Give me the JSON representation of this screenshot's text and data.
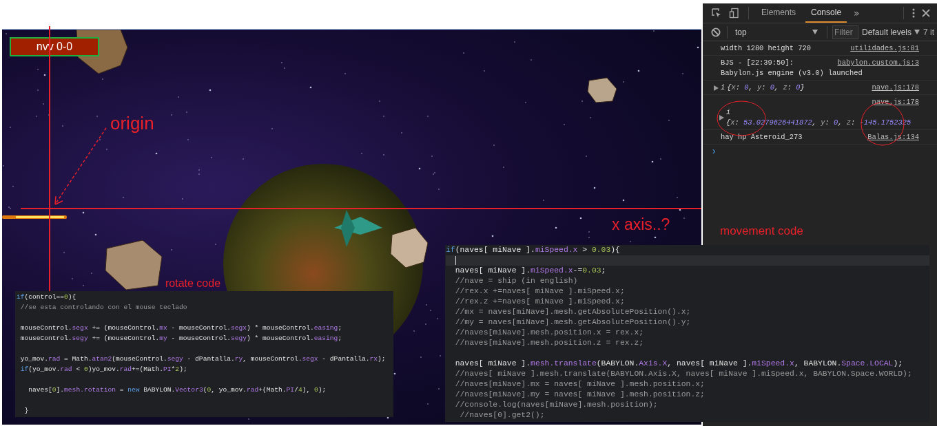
{
  "game": {
    "level_badge": "nvv 0-0"
  },
  "annotations": {
    "origin_label": "origin",
    "x_axis_label": "x axis..?",
    "rotate_label": "rotate code",
    "movement_label": "movement code"
  },
  "rotate_code": {
    "lines": [
      {
        "kind": "code",
        "tokens": [
          {
            "text": "if",
            "kind": "kw"
          },
          {
            "text": "(control==",
            "kind": "plain"
          },
          {
            "text": "0",
            "kind": "num"
          },
          {
            "text": "){",
            "kind": "plain"
          }
        ]
      },
      {
        "kind": "comment",
        "text": " //se esta controlando con el mouse teclado"
      },
      {
        "kind": "blank"
      },
      {
        "kind": "code",
        "tokens": [
          {
            "text": " mouseControl.",
            "kind": "plain"
          },
          {
            "text": "segx",
            "kind": "prop"
          },
          {
            "text": " += (mouseControl.",
            "kind": "plain"
          },
          {
            "text": "mx",
            "kind": "prop"
          },
          {
            "text": " - mouseControl.",
            "kind": "plain"
          },
          {
            "text": "segx",
            "kind": "prop"
          },
          {
            "text": ") * mouseControl.",
            "kind": "plain"
          },
          {
            "text": "easing",
            "kind": "prop"
          },
          {
            "text": ";",
            "kind": "plain"
          }
        ]
      },
      {
        "kind": "code",
        "tokens": [
          {
            "text": " mouseControl.",
            "kind": "plain"
          },
          {
            "text": "segy",
            "kind": "prop"
          },
          {
            "text": " += (mouseControl.",
            "kind": "plain"
          },
          {
            "text": "my",
            "kind": "prop"
          },
          {
            "text": " - mouseControl.",
            "kind": "plain"
          },
          {
            "text": "segy",
            "kind": "prop"
          },
          {
            "text": ") * mouseControl.",
            "kind": "plain"
          },
          {
            "text": "easing",
            "kind": "prop"
          },
          {
            "text": ";",
            "kind": "plain"
          }
        ]
      },
      {
        "kind": "blank"
      },
      {
        "kind": "code",
        "tokens": [
          {
            "text": " yo_mov.",
            "kind": "plain"
          },
          {
            "text": "rad",
            "kind": "prop"
          },
          {
            "text": " = Math.",
            "kind": "plain"
          },
          {
            "text": "atan2",
            "kind": "prop"
          },
          {
            "text": "(mouseControl.",
            "kind": "plain"
          },
          {
            "text": "segy",
            "kind": "prop"
          },
          {
            "text": " - dPantalla.",
            "kind": "plain"
          },
          {
            "text": "ry",
            "kind": "prop"
          },
          {
            "text": ", mouseControl.",
            "kind": "plain"
          },
          {
            "text": "segx",
            "kind": "prop"
          },
          {
            "text": " - dPantalla.",
            "kind": "plain"
          },
          {
            "text": "rx",
            "kind": "prop"
          },
          {
            "text": ");",
            "kind": "plain"
          }
        ]
      },
      {
        "kind": "code",
        "tokens": [
          {
            "text": " if",
            "kind": "kw"
          },
          {
            "text": "(yo_mov.",
            "kind": "plain"
          },
          {
            "text": "rad",
            "kind": "prop"
          },
          {
            "text": " < ",
            "kind": "plain"
          },
          {
            "text": "0",
            "kind": "num"
          },
          {
            "text": ")yo_mov.",
            "kind": "plain"
          },
          {
            "text": "rad",
            "kind": "prop"
          },
          {
            "text": "+=(Math.",
            "kind": "plain"
          },
          {
            "text": "PI",
            "kind": "prop"
          },
          {
            "text": "*",
            "kind": "plain"
          },
          {
            "text": "2",
            "kind": "num"
          },
          {
            "text": ");",
            "kind": "plain"
          }
        ]
      },
      {
        "kind": "blank"
      },
      {
        "kind": "code",
        "tokens": [
          {
            "text": "   naves[",
            "kind": "plain"
          },
          {
            "text": "0",
            "kind": "num"
          },
          {
            "text": "].",
            "kind": "plain"
          },
          {
            "text": "mesh.rotation",
            "kind": "prop"
          },
          {
            "text": " = ",
            "kind": "plain"
          },
          {
            "text": "new",
            "kind": "kw"
          },
          {
            "text": " BABYLON.",
            "kind": "plain"
          },
          {
            "text": "Vector3",
            "kind": "prop"
          },
          {
            "text": "(",
            "kind": "plain"
          },
          {
            "text": "0",
            "kind": "num"
          },
          {
            "text": ", yo_mov.",
            "kind": "plain"
          },
          {
            "text": "rad",
            "kind": "prop"
          },
          {
            "text": "+(Math.",
            "kind": "plain"
          },
          {
            "text": "PI",
            "kind": "prop"
          },
          {
            "text": "/",
            "kind": "plain"
          },
          {
            "text": "4",
            "kind": "num"
          },
          {
            "text": "), ",
            "kind": "plain"
          },
          {
            "text": "0",
            "kind": "num"
          },
          {
            "text": ");",
            "kind": "plain"
          }
        ]
      },
      {
        "kind": "blank"
      },
      {
        "kind": "code",
        "tokens": [
          {
            "text": "  }",
            "kind": "plain"
          }
        ]
      }
    ]
  },
  "movement_code": {
    "lines": [
      {
        "kind": "code",
        "tokens": [
          {
            "text": "if",
            "kind": "kw"
          },
          {
            "text": "(naves[ miNave ].",
            "kind": "plain"
          },
          {
            "text": "miSpeed.x",
            "kind": "prop"
          },
          {
            "text": " > ",
            "kind": "plain"
          },
          {
            "text": "0.03",
            "kind": "num"
          },
          {
            "text": "){",
            "kind": "plain"
          }
        ]
      },
      {
        "kind": "cursor"
      },
      {
        "kind": "code",
        "tokens": [
          {
            "text": "  naves[ miNave ].",
            "kind": "plain"
          },
          {
            "text": "miSpeed.x",
            "kind": "prop"
          },
          {
            "text": "-=",
            "kind": "plain"
          },
          {
            "text": "0.03",
            "kind": "num"
          },
          {
            "text": ";",
            "kind": "plain"
          }
        ]
      },
      {
        "kind": "comment",
        "text": "  //nave = ship (in english)"
      },
      {
        "kind": "comment",
        "text": "  //rex.x +=naves[ miNave ].miSpeed.x;"
      },
      {
        "kind": "comment",
        "text": "  //rex.z +=naves[ miNave ].miSpeed.x;"
      },
      {
        "kind": "comment",
        "text": "  //mx = naves[miNave].mesh.getAbsolutePosition().x;"
      },
      {
        "kind": "comment",
        "text": "  //my = naves[miNave].mesh.getAbsolutePosition().y;"
      },
      {
        "kind": "comment",
        "text": "  //naves[miNave].mesh.position.x = rex.x;"
      },
      {
        "kind": "comment",
        "text": "  //naves[miNave].mesh.position.z = rex.z;"
      },
      {
        "kind": "blank"
      },
      {
        "kind": "code",
        "tokens": [
          {
            "text": "  naves[ miNave ].",
            "kind": "plain"
          },
          {
            "text": "mesh.translate",
            "kind": "prop"
          },
          {
            "text": "(BABYLON.",
            "kind": "plain"
          },
          {
            "text": "Axis.X",
            "kind": "prop"
          },
          {
            "text": ", naves[ miNave ].",
            "kind": "plain"
          },
          {
            "text": "miSpeed.x",
            "kind": "prop"
          },
          {
            "text": ", BABYLON.",
            "kind": "plain"
          },
          {
            "text": "Space.LOCAL",
            "kind": "prop"
          },
          {
            "text": ");",
            "kind": "plain"
          }
        ]
      },
      {
        "kind": "comment",
        "text": "  //naves[ miNave ].mesh.translate(BABYLON.Axis.X, naves[ miNave ].miSpeed.x, BABYLON.Space.WORLD);"
      },
      {
        "kind": "comment",
        "text": "  //naves[miNave].mx = naves[ miNave ].mesh.position.x;"
      },
      {
        "kind": "comment",
        "text": "  //naves[miNave].my = naves[ miNave ].mesh.position.z;"
      },
      {
        "kind": "comment",
        "text": "  //console.log(naves[miNave].mesh.position);"
      },
      {
        "kind": "comment",
        "text": "   //naves[0].get2();"
      }
    ]
  },
  "devtools": {
    "tabs": [
      {
        "label": "Elements",
        "selected": false
      },
      {
        "label": "Console",
        "selected": true
      }
    ],
    "more_tabs": "»",
    "context": "top",
    "filter": {
      "placeholder": "Filter"
    },
    "levels": "Default levels",
    "hidden_count": "7 it",
    "messages": [
      {
        "kind": "text",
        "lines": [
          "width 1280 height 720"
        ],
        "source": "utilidades.js:81"
      },
      {
        "kind": "text",
        "lines": [
          "BJS - [22:39:50]:",
          "Babylon.js engine (v3.0) launched"
        ],
        "source": "babylon.custom.js:3"
      },
      {
        "kind": "object",
        "expanded": false,
        "label": "i",
        "tokens": [
          {
            "text": "{",
            "kind": "punct"
          },
          {
            "text": "x",
            "kind": "key"
          },
          {
            "text": ": ",
            "kind": "punct"
          },
          {
            "text": "0",
            "kind": "num"
          },
          {
            "text": ", ",
            "kind": "punct"
          },
          {
            "text": "y",
            "kind": "key"
          },
          {
            "text": ": ",
            "kind": "punct"
          },
          {
            "text": "0",
            "kind": "num"
          },
          {
            "text": ", ",
            "kind": "punct"
          },
          {
            "text": "z",
            "kind": "key"
          },
          {
            "text": ": ",
            "kind": "punct"
          },
          {
            "text": "0",
            "kind": "num"
          },
          {
            "text": "}",
            "kind": "punct"
          }
        ],
        "source": "nave.js:178"
      },
      {
        "kind": "object_wrapped",
        "expanded": false,
        "label": "i",
        "tokens": [
          {
            "text": "{",
            "kind": "punct"
          },
          {
            "text": "x",
            "kind": "key"
          },
          {
            "text": ": ",
            "kind": "punct"
          },
          {
            "text": "53.0279626441872",
            "kind": "num"
          },
          {
            "text": ", ",
            "kind": "punct"
          },
          {
            "text": "y",
            "kind": "key"
          },
          {
            "text": ": ",
            "kind": "punct"
          },
          {
            "text": "0",
            "kind": "num"
          },
          {
            "text": ", ",
            "kind": "punct"
          },
          {
            "text": "z",
            "kind": "key"
          },
          {
            "text": ": ",
            "kind": "punct"
          },
          {
            "text": "-145.1752325",
            "kind": "num"
          }
        ],
        "source": "nave.js:178"
      },
      {
        "kind": "text",
        "lines": [
          "hay hp Asteroid_273"
        ],
        "source": "Balas.js:134"
      }
    ],
    "prompt": "›"
  }
}
